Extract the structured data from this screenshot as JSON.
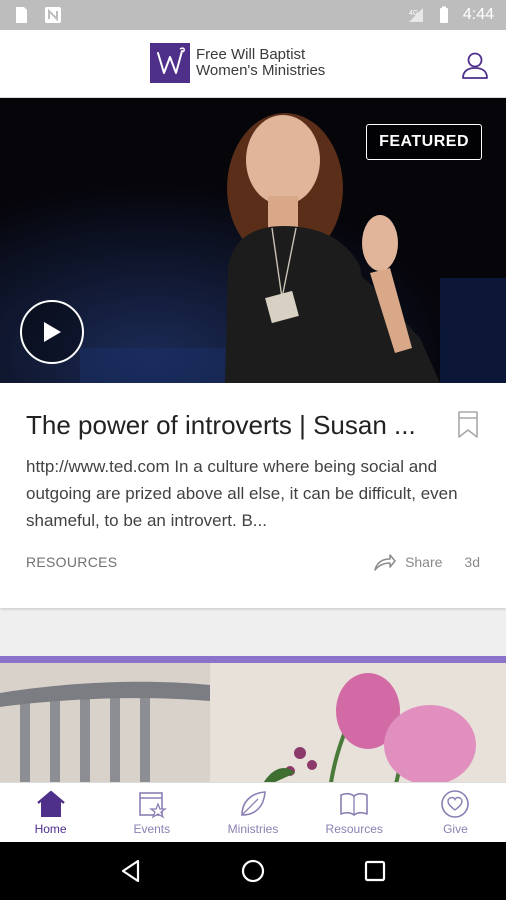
{
  "status_bar": {
    "time": "4:44",
    "icons": [
      "sd-card-icon",
      "notification-n-icon",
      "signal-icon",
      "battery-icon"
    ]
  },
  "header": {
    "logo_line1": "Free Will Baptist",
    "logo_line2": "Women's Ministries",
    "logo_monogram": "W",
    "profile_icon": "person-icon"
  },
  "featured_card": {
    "badge": "FEATURED",
    "title": "The power of introverts | Susan ...",
    "description": "http://www.ted.com In a culture where being social and outgoing are prized above all else, it can be difficult, even shameful, to be an introvert. B...",
    "category": "RESOURCES",
    "share_label": "Share",
    "time_ago": "3d"
  },
  "bottom_nav": {
    "items": [
      {
        "label": "Home",
        "icon": "home-icon",
        "active": true
      },
      {
        "label": "Events",
        "icon": "calendar-star-icon",
        "active": false
      },
      {
        "label": "Ministries",
        "icon": "leaf-icon",
        "active": false
      },
      {
        "label": "Resources",
        "icon": "book-icon",
        "active": false
      },
      {
        "label": "Give",
        "icon": "heart-circle-icon",
        "active": false
      }
    ]
  },
  "colors": {
    "brand": "#4e2f8a",
    "nav_inactive": "#8b7fb3",
    "accent_bar": "#8a73c9",
    "status_bar": "#bdbdbd"
  }
}
